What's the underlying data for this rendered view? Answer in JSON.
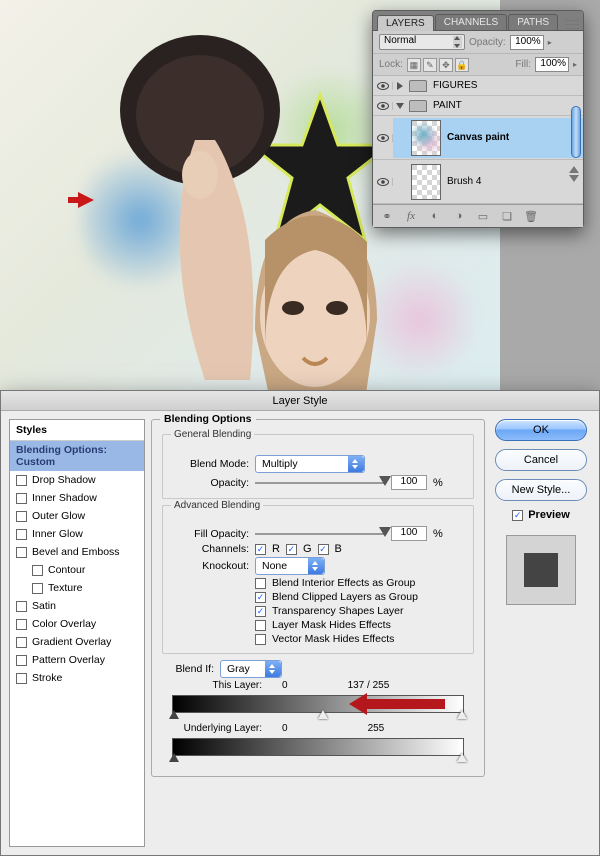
{
  "layers_panel": {
    "tabs": [
      "LAYERS",
      "CHANNELS",
      "PATHS"
    ],
    "blend_mode": "Normal",
    "opacity_label": "Opacity:",
    "opacity_value": "100%",
    "lock_label": "Lock:",
    "fill_label": "Fill:",
    "fill_value": "100%",
    "groups": {
      "figures": "FIGURES",
      "paint": "PAINT"
    },
    "layers": {
      "canvas_paint": "Canvas paint",
      "brush4": "Brush 4"
    }
  },
  "dialog": {
    "title": "Layer Style",
    "styles_header": "Styles",
    "style_items": {
      "blending_opts": "Blending Options: Custom",
      "drop_shadow": "Drop Shadow",
      "inner_shadow": "Inner Shadow",
      "outer_glow": "Outer Glow",
      "inner_glow": "Inner Glow",
      "bevel": "Bevel and Emboss",
      "contour": "Contour",
      "texture": "Texture",
      "satin": "Satin",
      "color_overlay": "Color Overlay",
      "gradient_overlay": "Gradient Overlay",
      "pattern_overlay": "Pattern Overlay",
      "stroke": "Stroke"
    },
    "blending": {
      "section": "Blending Options",
      "general": "General Blending",
      "blend_mode_label": "Blend Mode:",
      "blend_mode_value": "Multiply",
      "opacity_label": "Opacity:",
      "opacity_value": "100",
      "pct": "%",
      "advanced": "Advanced Blending",
      "fill_opacity_label": "Fill Opacity:",
      "fill_opacity_value": "100",
      "channels_label": "Channels:",
      "ch_r": "R",
      "ch_g": "G",
      "ch_b": "B",
      "knockout_label": "Knockout:",
      "knockout_value": "None",
      "opt_interior": "Blend Interior Effects as Group",
      "opt_clipped": "Blend Clipped Layers as Group",
      "opt_transparency": "Transparency Shapes Layer",
      "opt_layermask": "Layer Mask Hides Effects",
      "opt_vectormask": "Vector Mask Hides Effects",
      "blend_if_label": "Blend If:",
      "blend_if_value": "Gray",
      "this_layer_label": "This Layer:",
      "this_layer_low": "0",
      "this_layer_split": "137   /   255",
      "underlying_label": "Underlying Layer:",
      "underlying_low": "0",
      "underlying_high": "255"
    },
    "buttons": {
      "ok": "OK",
      "cancel": "Cancel",
      "new_style": "New Style...",
      "preview": "Preview"
    }
  }
}
